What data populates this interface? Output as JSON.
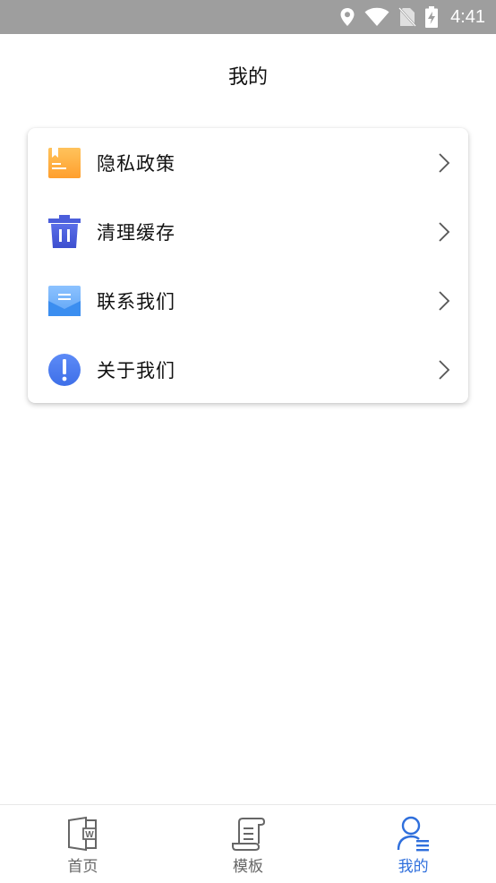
{
  "status_bar": {
    "time": "4:41",
    "icons": [
      "location-icon",
      "wifi-icon",
      "no-sim-icon",
      "battery-charging-icon"
    ]
  },
  "header": {
    "title": "我的"
  },
  "menu": {
    "items": [
      {
        "label": "隐私政策",
        "icon": "privacy-book-icon"
      },
      {
        "label": "清理缓存",
        "icon": "trash-icon"
      },
      {
        "label": "联系我们",
        "icon": "mail-icon"
      },
      {
        "label": "关于我们",
        "icon": "info-exclamation-icon"
      }
    ]
  },
  "bottom_nav": {
    "tabs": [
      {
        "label": "首页",
        "icon": "word-doc-icon",
        "active": false
      },
      {
        "label": "模板",
        "icon": "scroll-template-icon",
        "active": false
      },
      {
        "label": "我的",
        "icon": "user-profile-icon",
        "active": true
      }
    ],
    "active_color": "#2f6fdc",
    "inactive_color": "#666666"
  }
}
